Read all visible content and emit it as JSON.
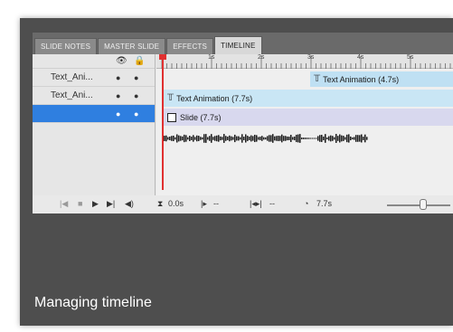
{
  "tabs": [
    "SLIDE NOTES",
    "MASTER SLIDE",
    "EFFECTS",
    "TIMELINE"
  ],
  "active_tab": "TIMELINE",
  "layers": [
    {
      "name": "Text_Ani..."
    },
    {
      "name": "Text_Ani..."
    },
    {
      "name": ""
    }
  ],
  "ruler_labels": [
    "1s",
    "2s",
    "3s",
    "4s",
    "5s"
  ],
  "bars": {
    "text_anim_top": "Text Animation (4.7s)",
    "text_anim": "Text Animation (7.7s)",
    "slide": "Slide (7.7s)"
  },
  "controls": {
    "start_time": "0.0s",
    "fade_in": "--",
    "fade_between": "--",
    "duration": "7.7s"
  },
  "caption": "Managing timeline",
  "colors": {
    "selection": "#2f7fe0",
    "playhead": "#e03030"
  },
  "icons": [
    "eye-icon",
    "lock-icon",
    "first-frame-icon",
    "stop-icon",
    "play-icon",
    "next-frame-icon",
    "audio-icon",
    "hourglass-icon",
    "fade-in-icon",
    "fade-between-icon",
    "stopwatch-icon"
  ]
}
